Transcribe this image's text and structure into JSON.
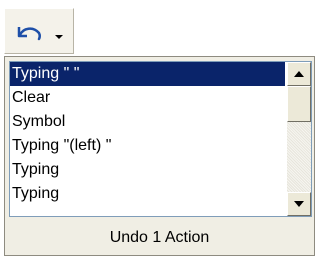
{
  "toolbar": {
    "undo_icon": "undo-arrow-icon",
    "dropdown_icon": "chevron-down-icon"
  },
  "undo_list": {
    "items": [
      {
        "label": "Typing \" \"",
        "selected": true
      },
      {
        "label": "Clear",
        "selected": false
      },
      {
        "label": "Symbol",
        "selected": false
      },
      {
        "label": "Typing \"(left) \"",
        "selected": false
      },
      {
        "label": "Typing",
        "selected": false
      },
      {
        "label": "Typing",
        "selected": false
      }
    ]
  },
  "scrollbar": {
    "up_icon": "scroll-up-arrow-icon",
    "down_icon": "scroll-down-arrow-icon"
  },
  "status": {
    "text": "Undo 1 Action"
  },
  "colors": {
    "selection_bg": "#0a246a",
    "selection_fg": "#ffffff",
    "panel_bg": "#f0eee4"
  }
}
